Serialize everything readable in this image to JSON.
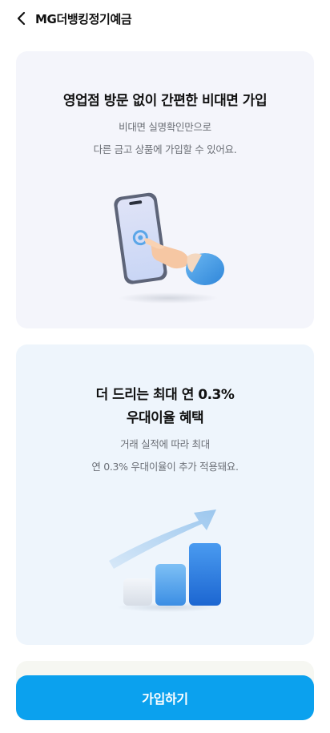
{
  "header": {
    "title": "MG더뱅킹정기예금"
  },
  "cards": [
    {
      "title": "영업점 방문 없이 간편한 비대면 가입",
      "desc_lines": [
        "비대면 실명확인만으로",
        "다른 금고 상품에 가입할 수 있어요."
      ],
      "illustration": "phone-tap-icon"
    },
    {
      "title_lines": [
        "더 드리는 최대 연 0.3%",
        "우대이율 혜택"
      ],
      "desc_lines": [
        "거래 실적에 따라 최대",
        "연 0.3% 우대이율이 추가 적용돼요."
      ],
      "illustration": "growth-chart-icon"
    }
  ],
  "cta": {
    "label": "가입하기"
  },
  "colors": {
    "primary": "#0ba1ee",
    "card1_bg": "#f4f5fb",
    "card2_bg": "#eef5fc"
  }
}
